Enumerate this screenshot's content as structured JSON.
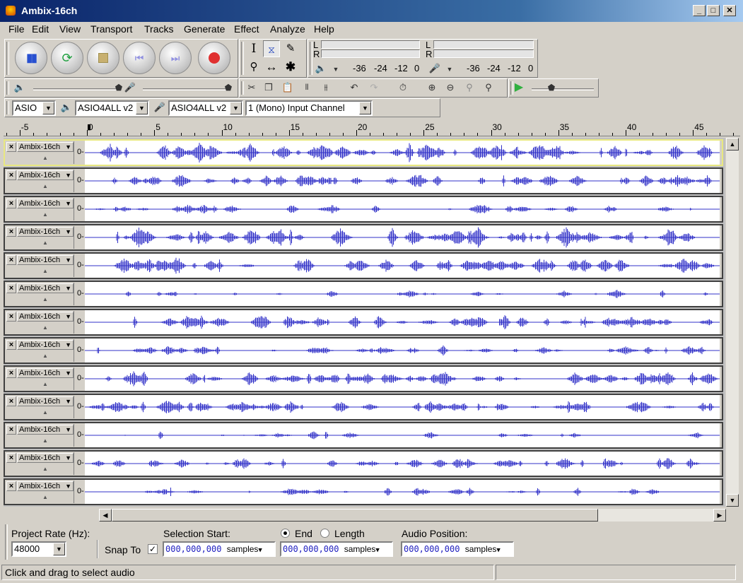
{
  "window": {
    "title": "Ambix-16ch",
    "controls": [
      "_",
      "□",
      "✕"
    ]
  },
  "menu": [
    "File",
    "Edit",
    "View",
    "Transport",
    "Tracks",
    "Generate",
    "Effect",
    "Analyze",
    "Help"
  ],
  "meter": {
    "play_scale": [
      "-36",
      "-24",
      "-12",
      "0"
    ],
    "rec_scale": [
      "-36",
      "-24",
      "-12",
      "0"
    ],
    "channels": [
      "L",
      "R"
    ]
  },
  "device": {
    "host": "ASIO",
    "output": "ASIO4ALL v2",
    "input": "ASIO4ALL v2",
    "channels": "1 (Mono) Input Channel"
  },
  "ruler": {
    "ticks": [
      "-5",
      "0",
      "5",
      "10",
      "15",
      "20",
      "25",
      "30",
      "35",
      "40",
      "45"
    ]
  },
  "track_name": "Ambix-16ch",
  "track_zero": "0-",
  "track_count": 13,
  "selection": {
    "rate_label": "Project Rate (Hz):",
    "rate_value": "48000",
    "snap_label": "Snap To",
    "snap_checked": "✓",
    "start_label": "Selection Start:",
    "end_label": "End",
    "length_label": "Length",
    "position_label": "Audio Position:",
    "time_value": "000,000,000",
    "unit": "samples"
  },
  "status": "Click and drag to select audio",
  "colors": {
    "wave": "#3232c8",
    "title_bar": "#0a246a"
  }
}
